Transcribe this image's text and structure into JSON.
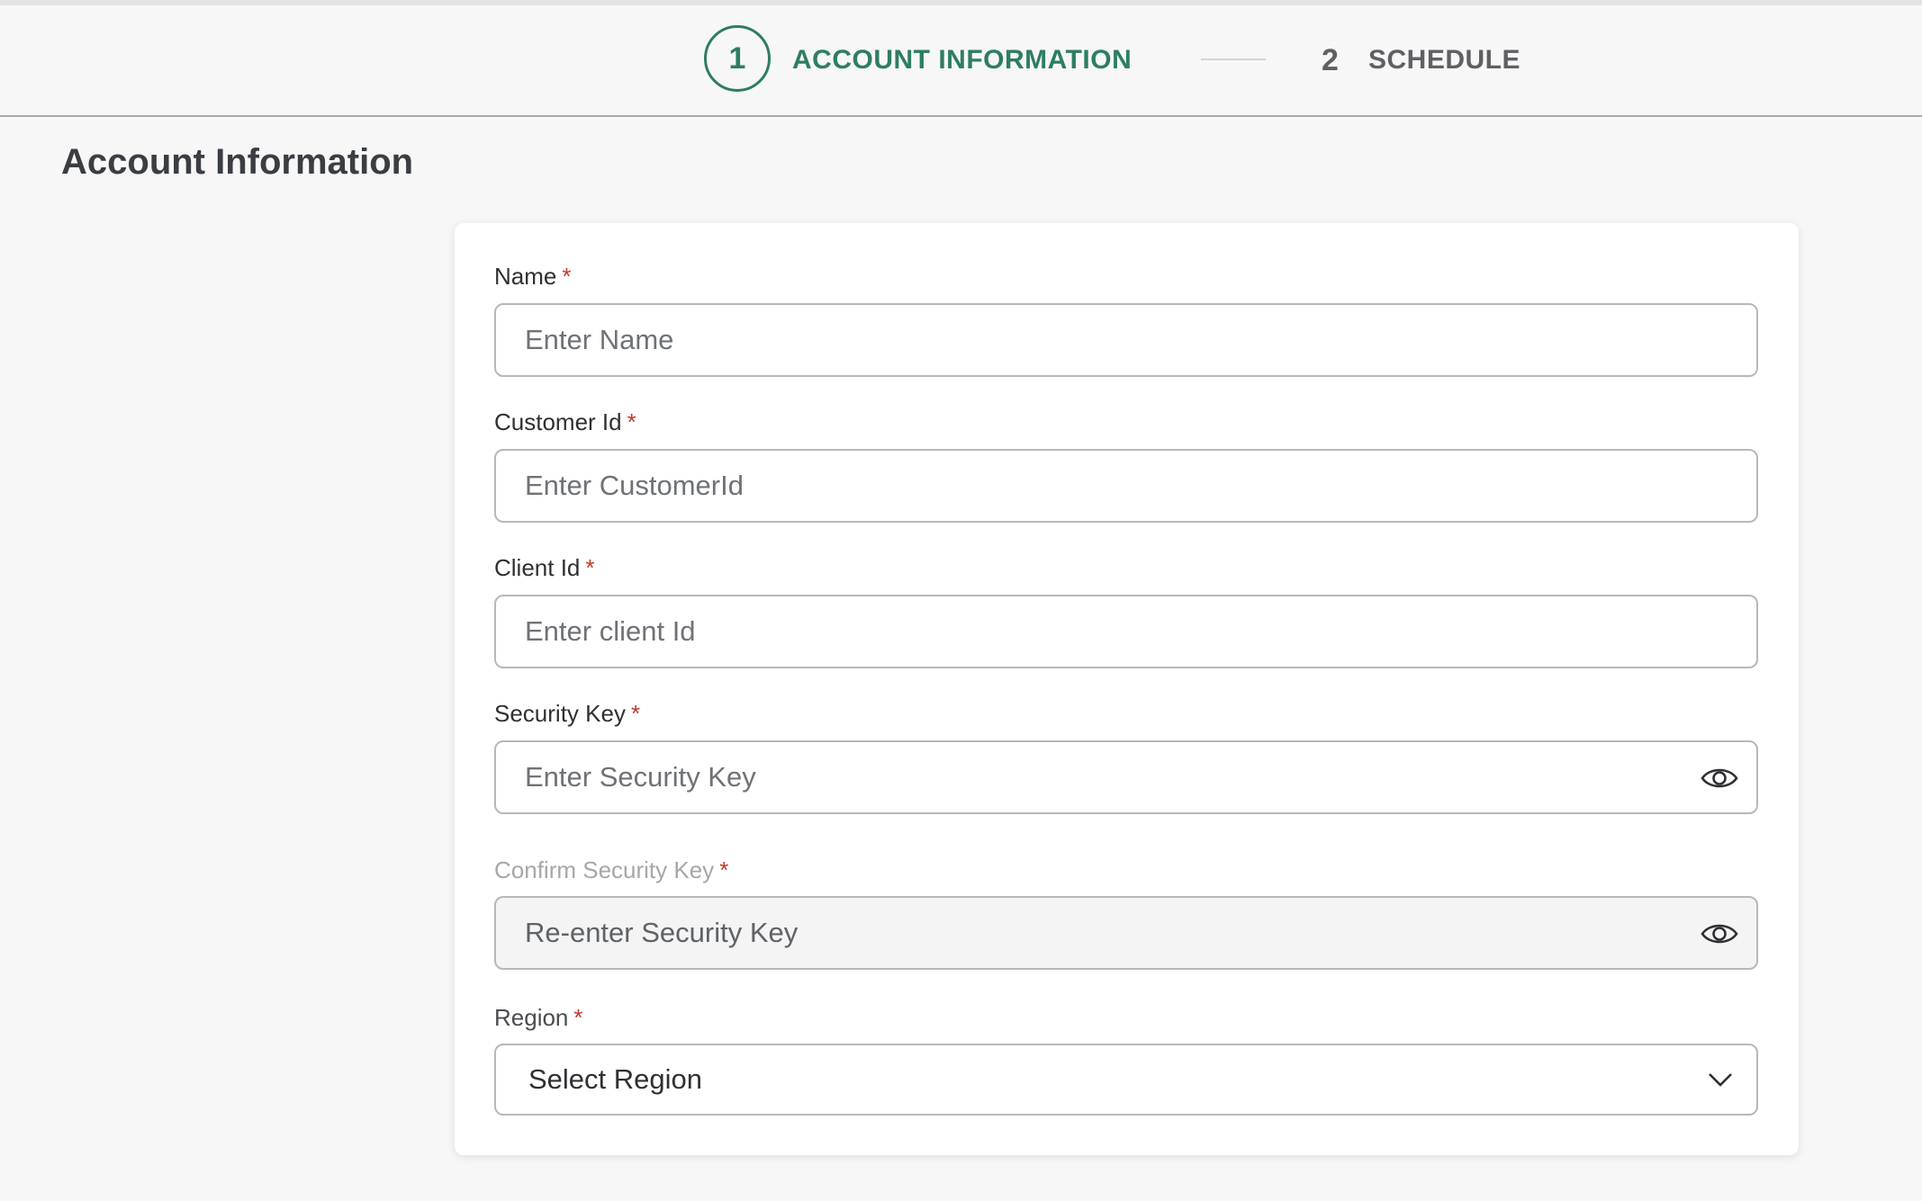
{
  "stepper": {
    "step1": {
      "number": "1",
      "label": "ACCOUNT INFORMATION",
      "state": "active"
    },
    "step2": {
      "number": "2",
      "label": "SCHEDULE",
      "state": "inactive"
    }
  },
  "page": {
    "title": "Account Information"
  },
  "form": {
    "required_marker": "*",
    "fields": [
      {
        "label": "Name",
        "placeholder": "Enter Name",
        "value": ""
      },
      {
        "label": "Customer Id",
        "placeholder": "Enter CustomerId",
        "value": ""
      },
      {
        "label": "Client Id",
        "placeholder": "Enter client Id",
        "value": ""
      },
      {
        "label": "Security Key",
        "placeholder": "Enter Security Key",
        "value": "",
        "icon": "eye-icon"
      },
      {
        "label": "Confirm Security Key",
        "placeholder": "Re-enter Security Key",
        "value": "",
        "icon": "eye-icon",
        "disabled": true
      }
    ],
    "region": {
      "label": "Region",
      "selected": "Select Region",
      "icon": "chevron-down-icon"
    }
  },
  "colors": {
    "accent": "#2e7d62",
    "required": "#c0392b",
    "inactive_step": "#5e6064",
    "background": "#f7f7f7",
    "card": "#ffffff"
  }
}
